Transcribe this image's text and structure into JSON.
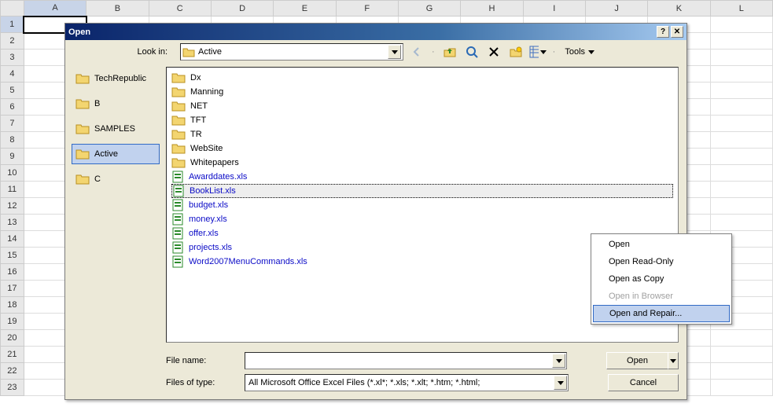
{
  "sheet": {
    "columns": [
      "A",
      "B",
      "C",
      "D",
      "E",
      "F",
      "G",
      "H",
      "I",
      "J",
      "K",
      "L"
    ],
    "rows": [
      "1",
      "2",
      "3",
      "4",
      "5",
      "6",
      "7",
      "8",
      "9",
      "10",
      "11",
      "12",
      "13",
      "14",
      "15",
      "16",
      "17",
      "18",
      "19",
      "20",
      "21",
      "22",
      "23"
    ],
    "selected_col": "A",
    "selected_row": "1"
  },
  "dialog": {
    "title": "Open",
    "lookin_label": "Look in:",
    "lookin_value": "Active",
    "tools_label": "Tools",
    "places": [
      {
        "label": "TechRepublic"
      },
      {
        "label": "B"
      },
      {
        "label": "SAMPLES"
      },
      {
        "label": "Active"
      },
      {
        "label": "C"
      }
    ],
    "selected_place": "Active",
    "files": [
      {
        "name": "Dx",
        "type": "folder"
      },
      {
        "name": "Manning",
        "type": "folder"
      },
      {
        "name": "NET",
        "type": "folder"
      },
      {
        "name": "TFT",
        "type": "folder"
      },
      {
        "name": "TR",
        "type": "folder"
      },
      {
        "name": "WebSite",
        "type": "folder"
      },
      {
        "name": "Whitepapers",
        "type": "folder"
      },
      {
        "name": "Awarddates.xls",
        "type": "xls"
      },
      {
        "name": "BookList.xls",
        "type": "xls"
      },
      {
        "name": "budget.xls",
        "type": "xls"
      },
      {
        "name": "money.xls",
        "type": "xls"
      },
      {
        "name": "offer.xls",
        "type": "xls"
      },
      {
        "name": "projects.xls",
        "type": "xls"
      },
      {
        "name": "Word2007MenuCommands.xls",
        "type": "xls"
      }
    ],
    "selected_file": "BookList.xls",
    "filename_label": "File name:",
    "filename_value": "",
    "filetype_label": "Files of type:",
    "filetype_value": "All Microsoft Office Excel Files (*.xl*; *.xls; *.xlt; *.htm; *.html;",
    "open_btn": "Open",
    "cancel_btn": "Cancel"
  },
  "context_menu": {
    "items": [
      {
        "label": "Open",
        "enabled": true
      },
      {
        "label": "Open Read-Only",
        "enabled": true
      },
      {
        "label": "Open as Copy",
        "enabled": true
      },
      {
        "label": "Open in Browser",
        "enabled": false
      },
      {
        "label": "Open and Repair...",
        "enabled": true
      }
    ],
    "highlighted": "Open and Repair..."
  }
}
